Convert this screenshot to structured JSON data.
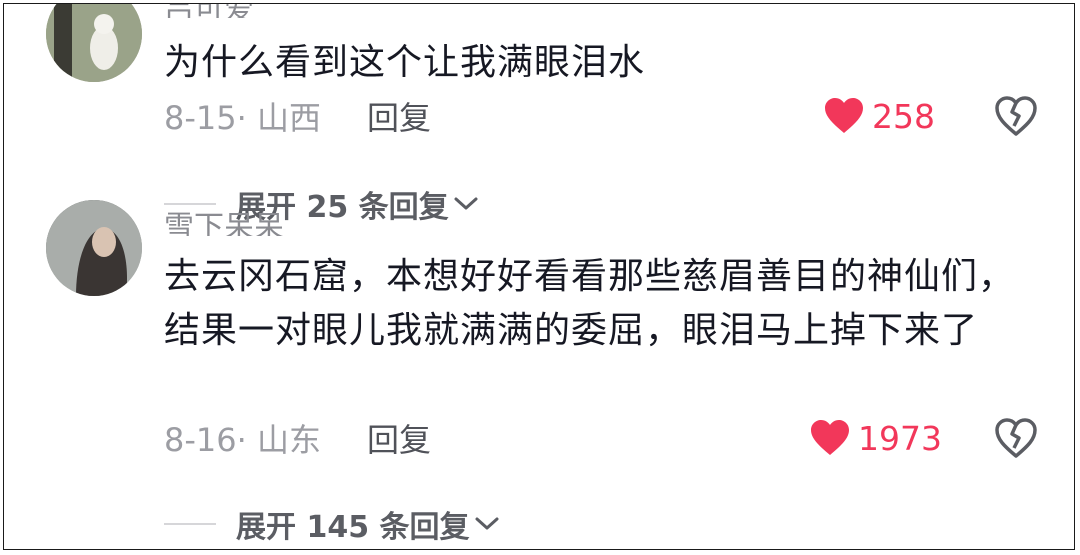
{
  "comments": [
    {
      "username": "吕可爱",
      "text": "为什么看到这个让我满眼泪水",
      "date_location": "8-15· 山西",
      "reply_label": "回复",
      "likes": "258",
      "expand_label": "展开 25 条回复"
    },
    {
      "username": "雪下呆呆",
      "text": "去云冈石窟，本想好好看看那些慈眉善目的神仙们，结果一对眼儿我就满满的委屈，眼泪马上掉下来了",
      "date_location": "8-16· 山东",
      "reply_label": "回复",
      "likes": "1973",
      "expand_label": "展开 145 条回复"
    }
  ],
  "colors": {
    "like": "#f2375a",
    "text": "#161823",
    "meta": "#9c9da3"
  },
  "icons": {
    "like": "heart-icon",
    "dislike": "broken-heart-icon",
    "expand": "chevron-down-icon"
  }
}
